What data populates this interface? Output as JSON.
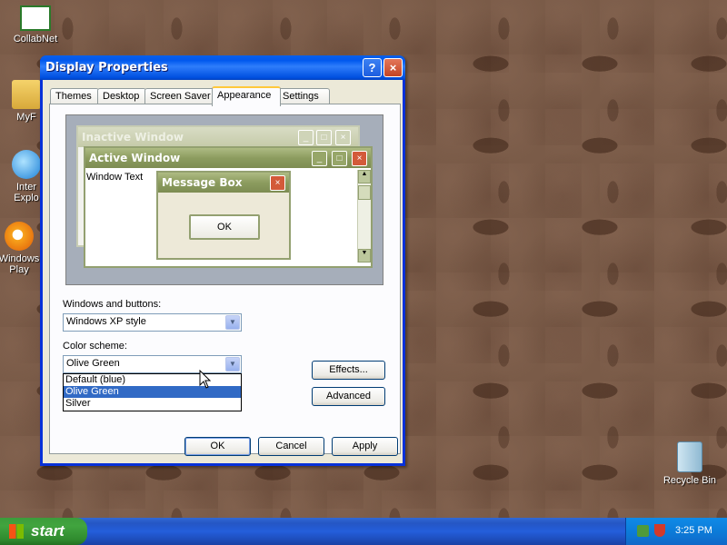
{
  "desktop": {
    "icons": [
      {
        "label": "CollabNet",
        "icon": "collabnet-icon"
      },
      {
        "label": "MyF",
        "icon": "my-documents-icon"
      },
      {
        "label": "Inter",
        "label2": "Explo",
        "icon": "internet-explorer-icon"
      },
      {
        "label": "Windows",
        "label2": "Play",
        "icon": "windows-media-player-icon"
      },
      {
        "label": "Recycle Bin",
        "icon": "recycle-bin-icon"
      }
    ]
  },
  "dialog": {
    "title": "Display Properties",
    "help_btn": "?",
    "close_btn": "×",
    "tabs": [
      "Themes",
      "Desktop",
      "Screen Saver",
      "Appearance",
      "Settings"
    ],
    "active_tab": "Appearance",
    "preview": {
      "inactive_title": "Inactive Window",
      "active_title": "Active Window",
      "window_text": "Window Text",
      "message_title": "Message Box",
      "ok": "OK"
    },
    "windows_buttons_label": "Windows and buttons:",
    "windows_buttons_value": "Windows XP style",
    "color_scheme_label": "Color scheme:",
    "color_scheme_value": "Olive Green",
    "color_scheme_options": [
      "Default (blue)",
      "Olive Green",
      "Silver"
    ],
    "color_scheme_highlighted": "Olive Green",
    "effects_btn": "Effects...",
    "advanced_btn": "Advanced",
    "ok_btn": "OK",
    "cancel_btn": "Cancel",
    "apply_btn": "Apply"
  },
  "taskbar": {
    "start_label": "start",
    "clock": "3:25 PM"
  },
  "colors": {
    "xp_blue": "#0058ee",
    "olive": "#93a070",
    "highlight": "#316ac5"
  }
}
